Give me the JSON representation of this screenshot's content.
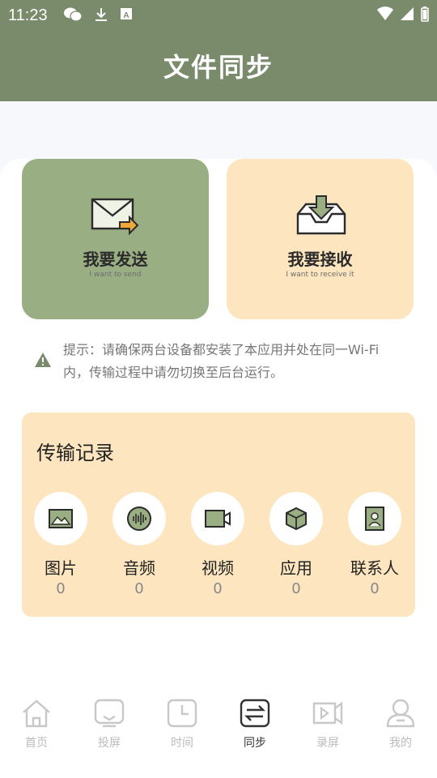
{
  "status": {
    "time": "11:23"
  },
  "header": {
    "title": "文件同步"
  },
  "send_card": {
    "title": "我要发送",
    "subtitle": "I want to send"
  },
  "receive_card": {
    "title": "我要接收",
    "subtitle": "I want to receive it"
  },
  "tip": {
    "text": "提示：请确保两台设备都安装了本应用并处在同一Wi-Fi内，传输过程中请勿切换至后台运行。"
  },
  "records": {
    "title": "传输记录",
    "items": [
      {
        "label": "图片",
        "count": "0",
        "icon": "image-icon"
      },
      {
        "label": "音频",
        "count": "0",
        "icon": "audio-icon"
      },
      {
        "label": "视频",
        "count": "0",
        "icon": "video-icon"
      },
      {
        "label": "应用",
        "count": "0",
        "icon": "app-icon"
      },
      {
        "label": "联系人",
        "count": "0",
        "icon": "contact-icon"
      }
    ]
  },
  "nav": {
    "items": [
      {
        "label": "首页",
        "icon": "home-icon"
      },
      {
        "label": "投屏",
        "icon": "cast-icon"
      },
      {
        "label": "时间",
        "icon": "clock-icon"
      },
      {
        "label": "同步",
        "icon": "sync-icon"
      },
      {
        "label": "录屏",
        "icon": "record-icon"
      },
      {
        "label": "我的",
        "icon": "profile-icon"
      }
    ],
    "active": "同步"
  },
  "colors": {
    "header": "#7a8b6c",
    "send_card": "#9aae84",
    "receive_card": "#fde6bf",
    "records_card": "#fde6bf"
  }
}
